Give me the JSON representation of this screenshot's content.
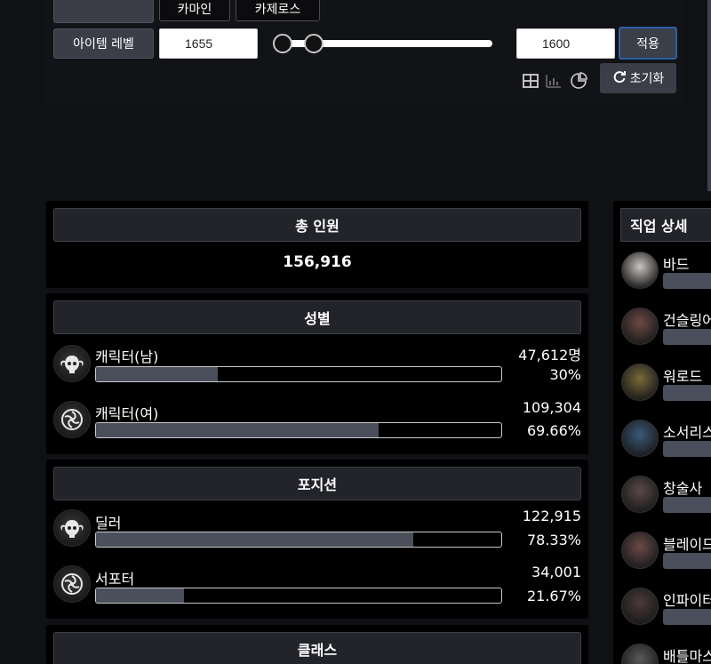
{
  "filters": {
    "server_tabs": [
      "카마인",
      "카제로스"
    ],
    "item_level_label": "아이템 레벨",
    "item_level_max": "1655",
    "item_level_min": "1600",
    "apply_label": "적용",
    "reset_label": "초기화",
    "view_icons": [
      "table-icon",
      "bar-chart-icon",
      "pie-chart-icon"
    ]
  },
  "total": {
    "title": "총 인원",
    "value": "156,916"
  },
  "gender": {
    "title": "성별",
    "rows": [
      {
        "label": "캐릭터(남)",
        "count": "47,612명",
        "percent": "30%",
        "fraction": 0.3,
        "icon": "ram-skull-icon"
      },
      {
        "label": "캐릭터(여)",
        "count": "109,304",
        "percent": "69.66%",
        "fraction": 0.6966,
        "icon": "swirl-emblem-icon"
      }
    ]
  },
  "position": {
    "title": "포지션",
    "rows": [
      {
        "label": "딜러",
        "count": "122,915",
        "percent": "78.33%",
        "fraction": 0.7833,
        "icon": "ram-skull-icon"
      },
      {
        "label": "서포터",
        "count": "34,001",
        "percent": "21.67%",
        "fraction": 0.2167,
        "icon": "swirl-emblem-icon"
      }
    ]
  },
  "class": {
    "title": "클래스"
  },
  "job_detail": {
    "title": "직업 상세",
    "jobs": [
      {
        "name": "바드",
        "avatar_color": "#c9c5c0"
      },
      {
        "name": "건슬링어",
        "avatar_color": "#6b4a45"
      },
      {
        "name": "워로드",
        "avatar_color": "#7a6a3a"
      },
      {
        "name": "소서리스",
        "avatar_color": "#3a5a7a"
      },
      {
        "name": "창술사",
        "avatar_color": "#5a4a48"
      },
      {
        "name": "블레이드",
        "avatar_color": "#6a4a4a"
      },
      {
        "name": "인파이터",
        "avatar_color": "#4a3a3a"
      },
      {
        "name": "배틀마스터",
        "avatar_color": "#5a5a5a"
      }
    ]
  }
}
